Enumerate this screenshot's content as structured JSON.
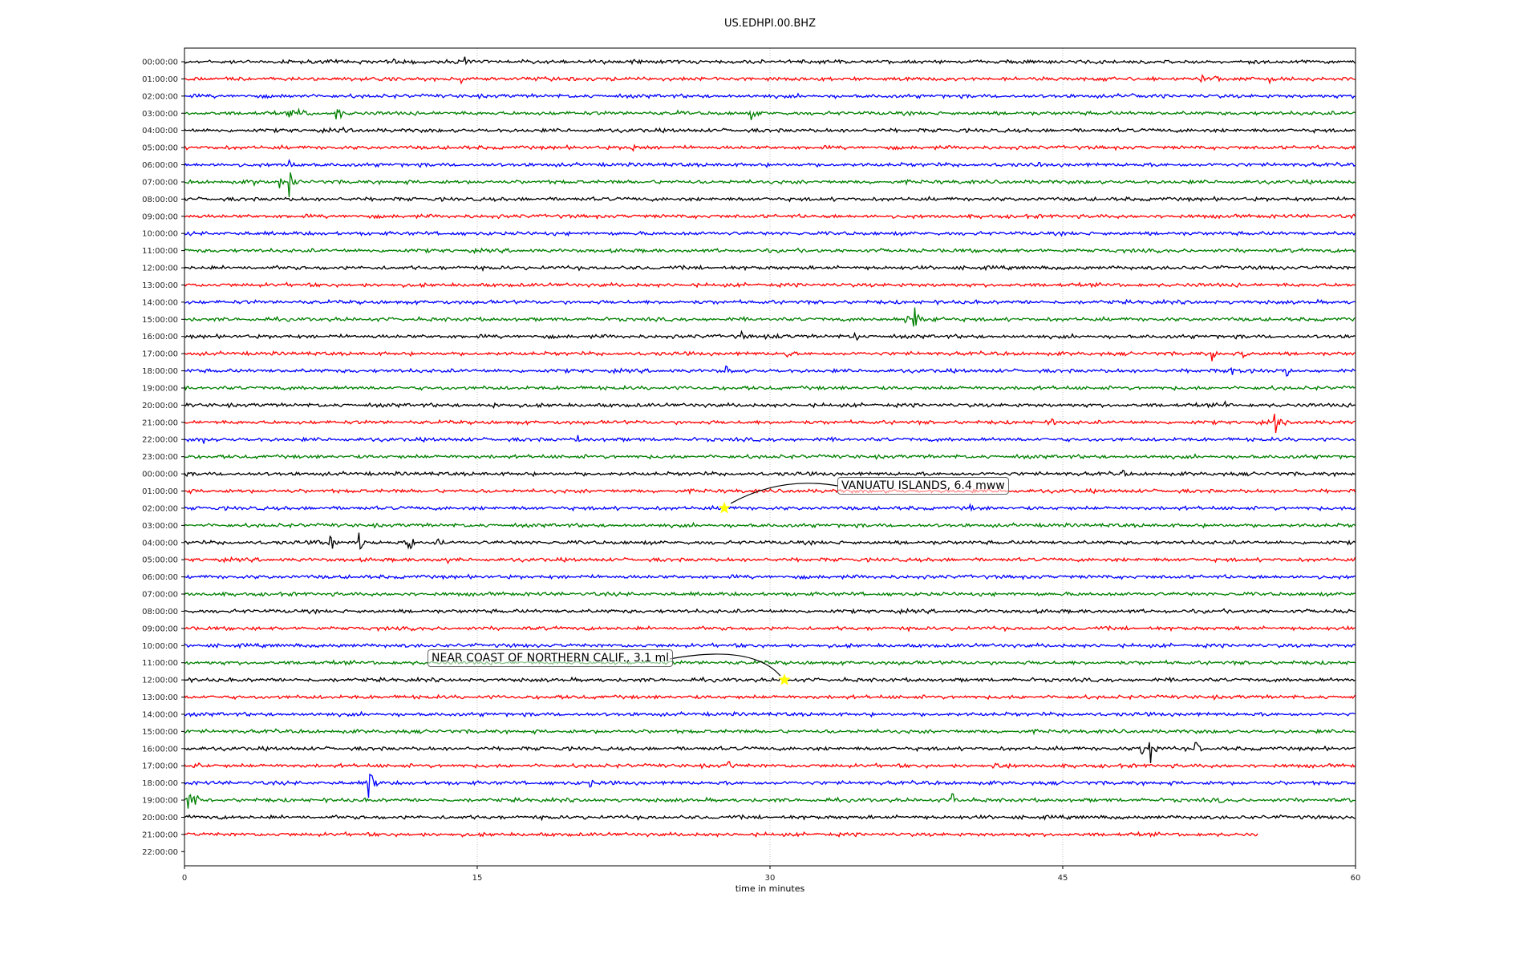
{
  "chart_data": {
    "type": "line",
    "title": "US.EDHPI.00.BHZ",
    "xlabel": "time in minutes",
    "ylabel": "",
    "xlim": [
      0,
      60
    ],
    "x_ticks": [
      "0",
      "15",
      "30",
      "45",
      "60"
    ],
    "x_tick_values": [
      0,
      15,
      30,
      45,
      60
    ],
    "grid": "vertical dotted at 15, 30, 45",
    "color_cycle": [
      "#000000",
      "#ff0000",
      "#0000ff",
      "#008000"
    ],
    "rows": [
      "00:00:00",
      "01:00:00",
      "02:00:00",
      "03:00:00",
      "04:00:00",
      "05:00:00",
      "06:00:00",
      "07:00:00",
      "08:00:00",
      "09:00:00",
      "10:00:00",
      "11:00:00",
      "12:00:00",
      "13:00:00",
      "14:00:00",
      "15:00:00",
      "16:00:00",
      "17:00:00",
      "18:00:00",
      "19:00:00",
      "20:00:00",
      "21:00:00",
      "22:00:00",
      "23:00:00",
      "00:00:00",
      "01:00:00",
      "02:00:00",
      "03:00:00",
      "04:00:00",
      "05:00:00",
      "06:00:00",
      "07:00:00",
      "08:00:00",
      "09:00:00",
      "10:00:00",
      "11:00:00",
      "12:00:00",
      "13:00:00",
      "14:00:00",
      "15:00:00",
      "16:00:00",
      "17:00:00",
      "18:00:00",
      "19:00:00",
      "20:00:00",
      "21:00:00",
      "22:00:00"
    ],
    "last_trace_end_minute": 55.0,
    "last_trace_row": 45,
    "events": [
      {
        "row": 0,
        "minute": 14.4,
        "amplitude": 10
      },
      {
        "row": 0,
        "minute": 46.8,
        "amplitude": 8
      },
      {
        "row": 0,
        "minute": 10.8,
        "amplitude": 4
      },
      {
        "row": 1,
        "minute": 52.1,
        "amplitude": 6
      },
      {
        "row": 1,
        "minute": 52.9,
        "amplitude": 5
      },
      {
        "row": 1,
        "minute": 55.6,
        "amplitude": 5
      },
      {
        "row": 1,
        "minute": 14.2,
        "amplitude": 4
      },
      {
        "row": 2,
        "minute": 48.6,
        "amplitude": 6
      },
      {
        "row": 2,
        "minute": 5.4,
        "amplitude": 4
      },
      {
        "row": 3,
        "minute": 5.4,
        "amplitude": 7
      },
      {
        "row": 3,
        "minute": 5.9,
        "amplitude": 6
      },
      {
        "row": 3,
        "minute": 7.8,
        "amplitude": 16
      },
      {
        "row": 3,
        "minute": 29.1,
        "amplitude": 8
      },
      {
        "row": 3,
        "minute": 25.3,
        "amplitude": 4
      },
      {
        "row": 4,
        "minute": 7.85,
        "amplitude": 9
      },
      {
        "row": 5,
        "minute": 23.0,
        "amplitude": 6
      },
      {
        "row": 6,
        "minute": 43.6,
        "amplitude": 6
      },
      {
        "row": 6,
        "minute": 5.4,
        "amplitude": 5
      },
      {
        "row": 7,
        "minute": 5.4,
        "amplitude": 18
      },
      {
        "row": 7,
        "minute": 4.9,
        "amplitude": 8
      },
      {
        "row": 7,
        "minute": 3.6,
        "amplitude": 4
      },
      {
        "row": 15,
        "minute": 37.4,
        "amplitude": 24
      },
      {
        "row": 15,
        "minute": 37.0,
        "amplitude": 10
      },
      {
        "row": 15,
        "minute": 38.4,
        "amplitude": 5
      },
      {
        "row": 16,
        "minute": 28.6,
        "amplitude": 5
      },
      {
        "row": 16,
        "minute": 30.4,
        "amplitude": 5
      },
      {
        "row": 16,
        "minute": 34.4,
        "amplitude": 6
      },
      {
        "row": 17,
        "minute": 52.7,
        "amplitude": 10
      },
      {
        "row": 17,
        "minute": 54.3,
        "amplitude": 6
      },
      {
        "row": 17,
        "minute": 30.9,
        "amplitude": 5
      },
      {
        "row": 18,
        "minute": 27.8,
        "amplitude": 7
      },
      {
        "row": 18,
        "minute": 53.7,
        "amplitude": 6
      },
      {
        "row": 18,
        "minute": 56.4,
        "amplitude": 10
      },
      {
        "row": 20,
        "minute": 15.8,
        "amplitude": 6
      },
      {
        "row": 20,
        "minute": 53.4,
        "amplitude": 4
      },
      {
        "row": 21,
        "minute": 55.9,
        "amplitude": 14
      },
      {
        "row": 21,
        "minute": 44.5,
        "amplitude": 5
      },
      {
        "row": 22,
        "minute": 20.2,
        "amplitude": 5
      },
      {
        "row": 22,
        "minute": 1.0,
        "amplitude": 4
      },
      {
        "row": 24,
        "minute": 48.1,
        "amplitude": 4
      },
      {
        "row": 26,
        "minute": 40.3,
        "amplitude": 6
      },
      {
        "row": 28,
        "minute": 7.5,
        "amplitude": 15
      },
      {
        "row": 28,
        "minute": 9.0,
        "amplitude": 14
      },
      {
        "row": 28,
        "minute": 11.5,
        "amplitude": 12
      },
      {
        "row": 28,
        "minute": 6.8,
        "amplitude": 6
      },
      {
        "row": 28,
        "minute": 13.0,
        "amplitude": 5
      },
      {
        "row": 29,
        "minute": 13.5,
        "amplitude": 6
      },
      {
        "row": 40,
        "minute": 49.5,
        "amplitude": 18
      },
      {
        "row": 40,
        "minute": 49.0,
        "amplitude": 8
      },
      {
        "row": 40,
        "minute": 51.8,
        "amplitude": 12
      },
      {
        "row": 41,
        "minute": 27.9,
        "amplitude": 8
      },
      {
        "row": 41,
        "minute": 0.8,
        "amplitude": 5
      },
      {
        "row": 41,
        "minute": 41.6,
        "amplitude": 5
      },
      {
        "row": 42,
        "minute": 9.5,
        "amplitude": 22
      },
      {
        "row": 42,
        "minute": 20.8,
        "amplitude": 5
      },
      {
        "row": 43,
        "minute": 0.2,
        "amplitude": 12
      },
      {
        "row": 43,
        "minute": 0.55,
        "amplitude": 12
      },
      {
        "row": 43,
        "minute": 39.4,
        "amplitude": 8
      },
      {
        "row": 43,
        "minute": 53.0,
        "amplitude": 4
      }
    ],
    "annotations": [
      {
        "text": "VANUATU ISLANDS, 6.4 mww",
        "row": 26,
        "minute": 27.66,
        "box_color": "#ff0000"
      },
      {
        "text": "NEAR COAST OF NORTHERN CALIF., 3.1 ml",
        "row": 36,
        "minute": 30.74,
        "box_color": "#008000"
      }
    ],
    "marker_color": "#ffff00"
  }
}
